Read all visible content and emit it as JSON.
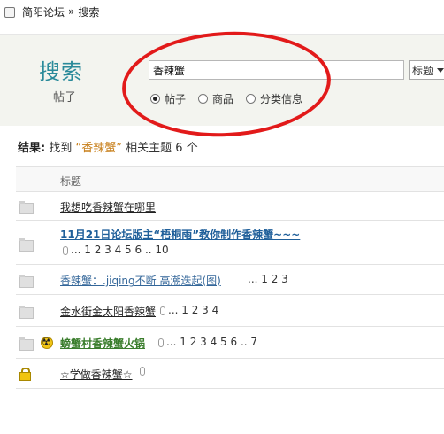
{
  "breadcrumb": {
    "forum": "简阳论坛",
    "sep": "»",
    "current": "搜索"
  },
  "search": {
    "title": "搜索",
    "subtitle": "帖子",
    "query": "香辣蟹",
    "scope_select": "标题",
    "radios": [
      {
        "label": "帖子",
        "checked": true
      },
      {
        "label": "商品",
        "checked": false
      },
      {
        "label": "分类信息",
        "checked": false
      }
    ]
  },
  "results": {
    "prefix": "结果:",
    "text1": "找到",
    "keyword": "“香辣蟹”",
    "text2": "相关主题",
    "count": "6",
    "unit": "个"
  },
  "table": {
    "column_title": "标题",
    "rows": [
      {
        "title": "我想吃香辣蟹在哪里",
        "pager": ""
      },
      {
        "title": "11月21日论坛版主“梧桐雨”教你制作香辣蟹~~~",
        "pager": "... 1 2 3 4 5 6 .. 10"
      },
      {
        "title": "香辣蟹：.jiqing不断  高潮迭起(图)",
        "pager": "... 1 2 3"
      },
      {
        "title": "金水街金太阳香辣蟹",
        "pager": "... 1 2 3 4"
      },
      {
        "title": "螃蟹村香辣蟹火锅",
        "pager": "... 1 2 3 4 5 6 .. 7"
      },
      {
        "title": "☆学做香辣蟹☆",
        "pager": ""
      }
    ]
  }
}
